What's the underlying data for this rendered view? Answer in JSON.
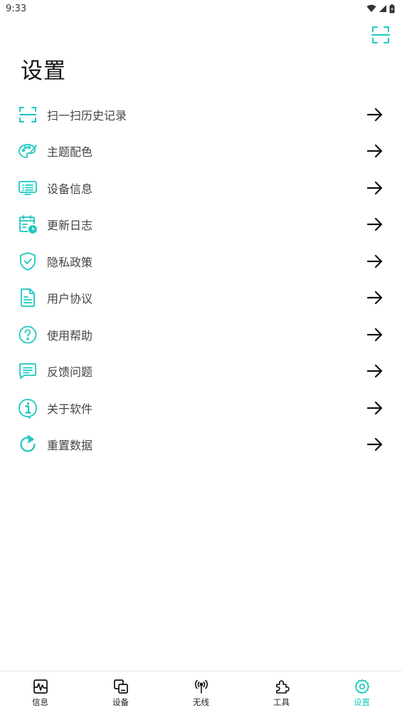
{
  "status_bar": {
    "time": "9:33",
    "icons": [
      "wifi-icon",
      "signal-icon",
      "battery-icon"
    ]
  },
  "colors": {
    "accent": "#1bc8c0",
    "text": "#444444",
    "title": "#111111"
  },
  "header": {
    "title": "设置",
    "scan_icon": "scan-icon"
  },
  "menu": {
    "items": [
      {
        "label": "扫一扫历史记录",
        "icon": "scan-history-icon"
      },
      {
        "label": "主题配色",
        "icon": "palette-icon"
      },
      {
        "label": "设备信息",
        "icon": "monitor-icon"
      },
      {
        "label": "更新日志",
        "icon": "calendar-clock-icon"
      },
      {
        "label": "隐私政策",
        "icon": "shield-check-icon"
      },
      {
        "label": "用户协议",
        "icon": "document-icon"
      },
      {
        "label": "使用帮助",
        "icon": "help-icon"
      },
      {
        "label": "反馈问题",
        "icon": "message-icon"
      },
      {
        "label": "关于软件",
        "icon": "info-icon"
      },
      {
        "label": "重置数据",
        "icon": "refresh-icon"
      }
    ]
  },
  "bottom_nav": {
    "items": [
      {
        "label": "信息",
        "icon": "activity-icon",
        "active": false
      },
      {
        "label": "设备",
        "icon": "devices-icon",
        "active": false
      },
      {
        "label": "无线",
        "icon": "antenna-icon",
        "active": false
      },
      {
        "label": "工具",
        "icon": "puzzle-icon",
        "active": false
      },
      {
        "label": "设置",
        "icon": "settings-gear-icon",
        "active": true
      }
    ]
  }
}
